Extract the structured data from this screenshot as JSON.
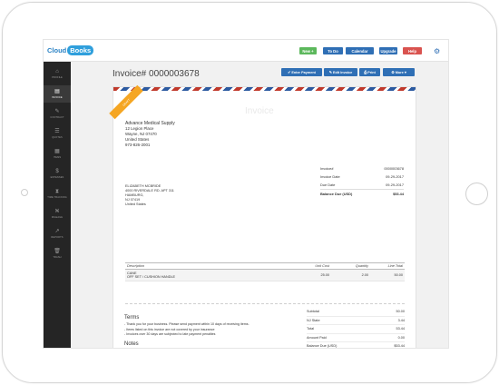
{
  "topbar": {
    "logo_text": "Cloud",
    "logo_badge": "Books",
    "new_label": "New +",
    "todo_label": "To Do",
    "calendar_label": "Calendar",
    "upgrade_label": "Upgrade",
    "help_label": "Help"
  },
  "sidebar": {
    "items": [
      {
        "label": "PROFILE",
        "icon": "home-icon"
      },
      {
        "label": "INVOICE",
        "icon": "document-icon"
      },
      {
        "label": "CONTRACT",
        "icon": "pen-icon"
      },
      {
        "label": "QUOTES",
        "icon": "list-icon"
      },
      {
        "label": "ITEMS",
        "icon": "grid-icon"
      },
      {
        "label": "EXPENSES",
        "icon": "dollar-icon"
      },
      {
        "label": "TIME TRACKING",
        "icon": "hourglass-icon"
      },
      {
        "label": "MILEAGE",
        "icon": "road-icon"
      },
      {
        "label": "REPORTS",
        "icon": "chart-icon"
      },
      {
        "label": "TRASH",
        "icon": "trash-icon"
      }
    ],
    "active_index": 1
  },
  "page": {
    "title": "Invoice# 0000003678",
    "actions": {
      "email": "Enter Payment",
      "edit": "Edit Invoice",
      "print": "Print",
      "more": "More"
    }
  },
  "invoice": {
    "ribbon": "DRAFT",
    "watermark": "Invoice",
    "company": {
      "name": "Advance Medical Supply",
      "line1": "12 Legion Place",
      "line2": "Wayne, NJ 07470",
      "line3": "United States",
      "phone": "973-826-2001"
    },
    "bill_to": {
      "name": "ELIZABETH MCBRIDE",
      "line1": "4000 RIVERDALE RD. APT 311",
      "line2": "HAMBURG,",
      "line3": "NJ 07419",
      "line4": "United States"
    },
    "meta": {
      "invoice_label": "Invoice#",
      "invoice_value": "0000003678",
      "date_label": "Invoice Date",
      "date_value": "09-29-2017",
      "due_label": "Due Date",
      "due_value": "09-29-2017",
      "balance_label": "Balance Due (USD)",
      "balance_value": "$53.44"
    },
    "items_header": {
      "description": "Description",
      "unit_cost": "Unit Cost",
      "quantity": "Quantity",
      "line_total": "Line Total"
    },
    "items": [
      {
        "desc1": "CANE",
        "desc2": "OFF SET / CUSHION HANDLE",
        "unit_cost": "25.00",
        "quantity": "2.00",
        "line_total": "50.00"
      }
    ],
    "totals": {
      "subtotal_label": "Subtotal",
      "subtotal_value": "50.00",
      "tax_label": "NJ State",
      "tax_value": "3.44",
      "total_label": "Total",
      "total_value": "53.44",
      "paid_label": "Amount Paid",
      "paid_value": "0.00",
      "balance_label": "Balance Due (USD)",
      "balance_value": "$53.44"
    },
    "terms_title": "Terms",
    "terms": [
      "- Thank you for your business. Please send payment within 10 days of receiving items.",
      "- Items listed on this invoice are not covered by your insurance",
      "- Invoices over 30 days are subjected to late payment penalties"
    ],
    "notes_title": "Notes"
  }
}
